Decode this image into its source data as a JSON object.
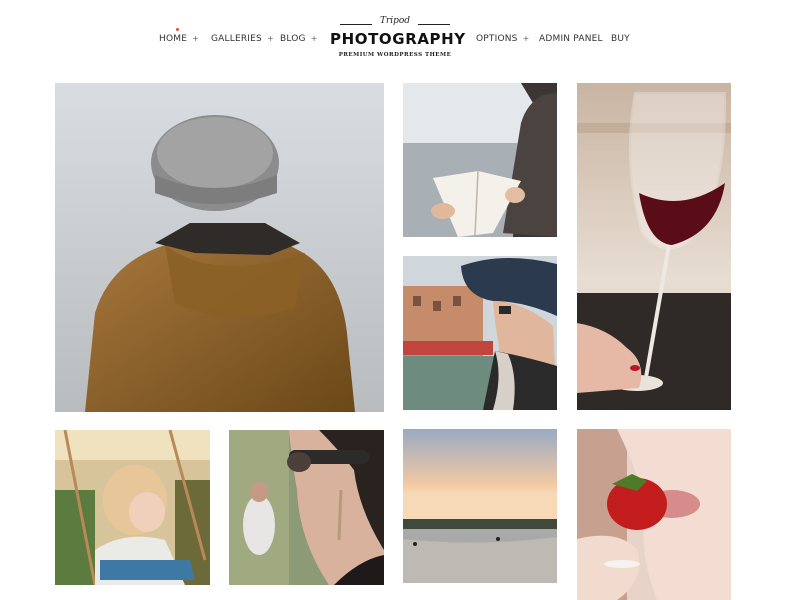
{
  "header": {
    "nav_left": [
      {
        "label": "HOME",
        "chevron": "+"
      },
      {
        "label": "GALLERIES",
        "chevron": "+"
      },
      {
        "label": "BLOG",
        "chevron": "+"
      }
    ],
    "logo": {
      "tagline": "Tripod",
      "brand": "PHOTOGRAPHY",
      "subtitle": "PREMIUM WORDPRESS THEME"
    },
    "nav_right": [
      {
        "label": "OPTIONS",
        "chevron": "+"
      },
      {
        "label": "ADMIN PANEL"
      },
      {
        "label": "BUY"
      }
    ],
    "active_color": "#e44c3a"
  },
  "gallery": {
    "photos": [
      {
        "name": "man-beanie-jacket-photo"
      },
      {
        "name": "reading-book-photo"
      },
      {
        "name": "red-wine-glass-photo"
      },
      {
        "name": "woman-sunhat-venice-photo"
      },
      {
        "name": "child-on-swing-photo"
      },
      {
        "name": "woman-sunglasses-earring-photo"
      },
      {
        "name": "sunset-beach-photo"
      },
      {
        "name": "strawberry-lips-photo"
      }
    ]
  }
}
